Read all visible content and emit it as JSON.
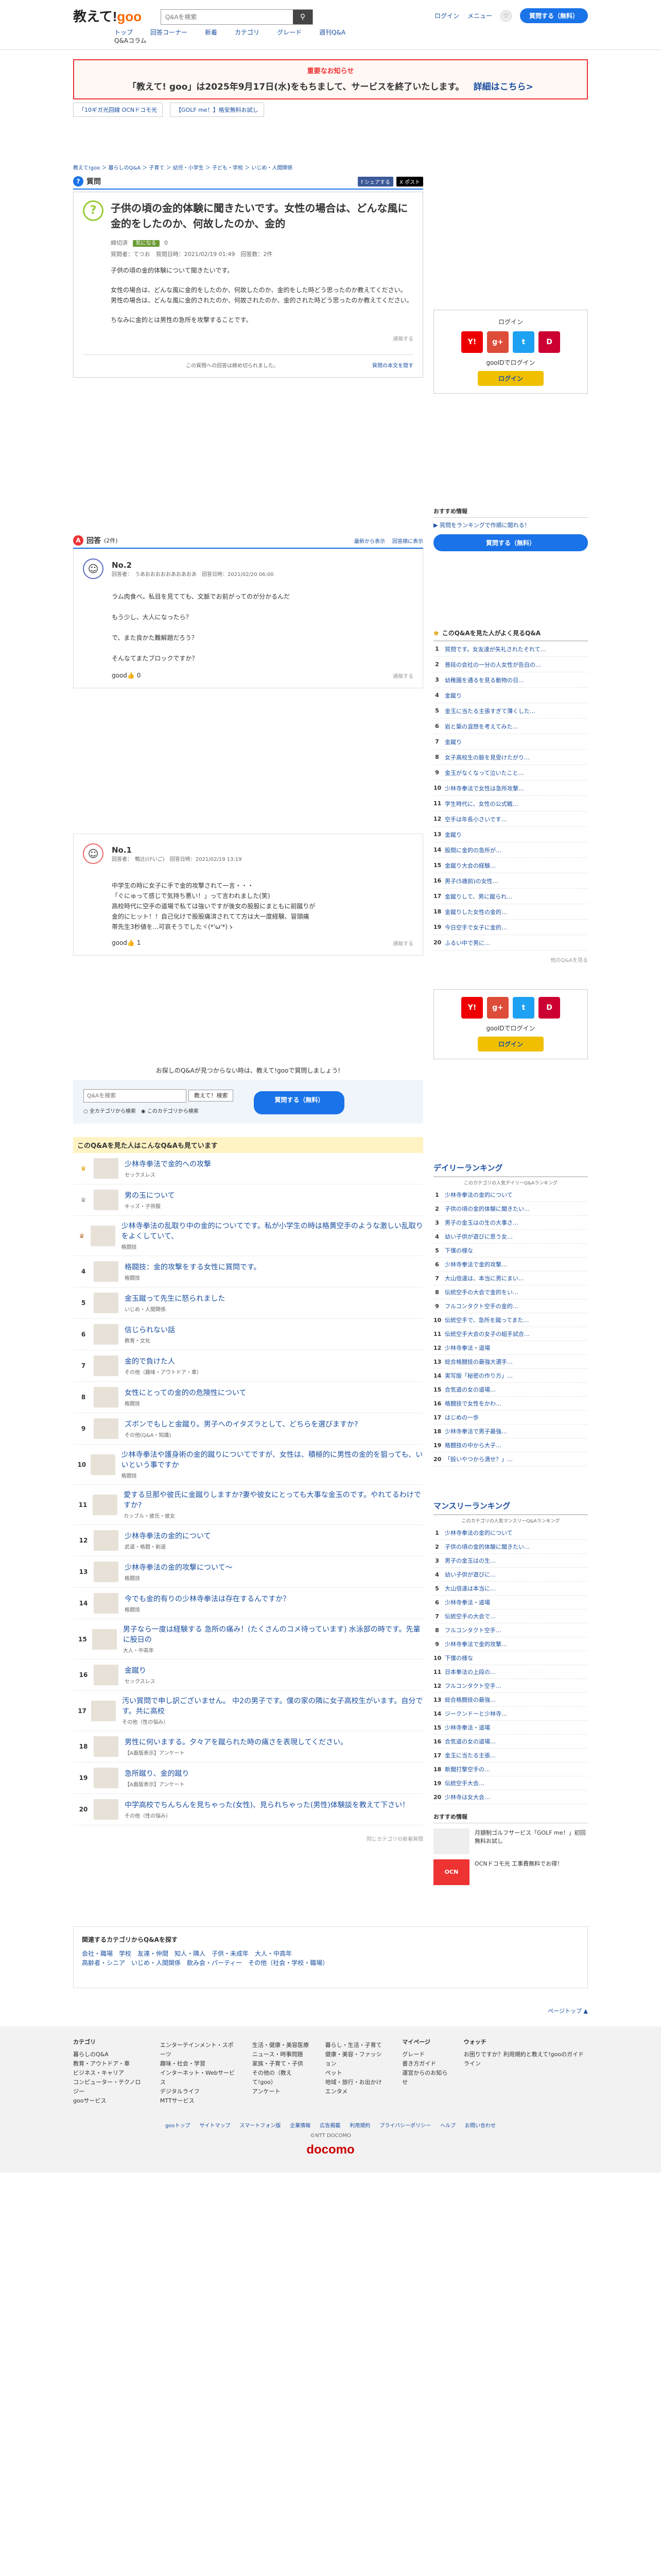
{
  "header": {
    "logo": "教えて!",
    "logo_goo": "goo",
    "search_placeholder": "Q&Aを検索",
    "search_icon": "search-icon",
    "login": "ログイン",
    "menu": "メニュー",
    "ask_button": "質問する（無料）",
    "nav": [
      "トップ",
      "回答コーナー",
      "新着",
      "カテゴリ",
      "グレード",
      "週刊Q&A"
    ],
    "nav2": "Q&Aコラム"
  },
  "notice": {
    "title": "重要なお知らせ",
    "body": "「教えて! goo」は2025年9月17日(水)をもちまして、サービスを終了いたします。",
    "link": "詳細はこちら>"
  },
  "promo": [
    "「10ギガ光回線 OCNドコモ光",
    "【GOLF me！】格安無料お試し"
  ],
  "breadcrumb": "教えて!goo ＞ 暮らしのQ&A ＞ 子育て ＞ 幼児・小学生 ＞ 子ども・学校 ＞ いじめ・人間関係",
  "question": {
    "label": "質問",
    "share": [
      "f シェアする",
      "X ポスト"
    ],
    "title": "子供の頃の金的体験に聞きたいです。女性の場合は、どんな風に金的をしたのか、何故したのか、金的",
    "user": "締切済",
    "badge": "気になる",
    "count": "0",
    "meta": "質問者：てつお　質問日時：2021/02/19 01:49　回答数：2件",
    "body": [
      "子供の頃の金的体験について聞きたいです。",
      "女性の場合は、どんな風に金的をしたのか、何故したのか、金的をした時どう思ったのか教えてください。\n男性の場合は、どんな風に金的されたのか、何故されたのか、金的された時どう思ったのか教えてください。",
      "ちなみに金的とは男性の急所を攻撃することです。"
    ],
    "report": "通報する",
    "closed": "この質問への回答は締め切られました。",
    "back": "質問の本文を隠す"
  },
  "answers": {
    "label": "回答",
    "count": "(2件)",
    "sort": [
      "最新から表示",
      "回答順に表示"
    ],
    "items": [
      {
        "no": "No.2",
        "meta": "回答者：　うあおおおおおあおあおあ　回答日時：2021/02/20 06:00",
        "body": [
          "ラム肉食べ。私目を見てても、文脈でお前がってのが分かるんだ",
          "もう少し、大人になったら？",
          "で、また良かた難解題だろう？",
          "そんなてまたブロックですか？"
        ],
        "good": "good",
        "good_n": "0",
        "report": "通報する"
      },
      {
        "no": "No.1",
        "meta": "回答者：　鴨辻(けいご)　回答日時：2021/02/19 13:19",
        "body": "中学生の時に女子に手で金的攻撃されて一言・・・\n「ぐにゅって感じで気持ち悪い！」って言われました(笑)\n高校時代に空手の道場で私ては強いですが後女の股股にまともに前蹴りが\n金的にヒット！！自己化けで股股痛済されてて方は大一度経験、冒頭痛\n帯先生3秒値を...可哀そうでしたヾ(*'ω'*)ゝ",
        "good": "good",
        "good_n": "1",
        "report": "通報する"
      }
    ]
  },
  "ask_prompt": "お探しのQ&Aが見つからない時は、教えて!gooで質問しましょう!",
  "ask_box": {
    "placeholder": "Q&Aを検索",
    "search_btn": "教えて！検索",
    "opt1": "全カテゴリから検索",
    "opt2": "このカテゴリから検索",
    "ask": "質問する（無料）"
  },
  "related": {
    "title": "このQ&Aを見た人はこんなQ&Aも見ています",
    "items": [
      {
        "t": "少林寺拳法で金的への攻撃",
        "c": "セックスレス"
      },
      {
        "t": "男の玉について",
        "c": "キッズ・子供服"
      },
      {
        "t": "少林寺拳法の乱取り中の金的についてです。私が小学生の時は格黄空手のような激しい乱取りをよくしていて、",
        "c": "格闘技"
      },
      {
        "t": "格闘技：金的攻撃をする女性に質問です。",
        "c": "格闘技"
      },
      {
        "t": "金玉蹴って先生に怒られました",
        "c": "いじめ・人間関係"
      },
      {
        "t": "信じられない話",
        "c": "教育・文化"
      },
      {
        "t": "金的で負けた人",
        "c": "その他（趣味・アウトドア・車）"
      },
      {
        "t": "女性にとっての金的の危険性について",
        "c": "格闘技"
      },
      {
        "t": "ズボンでもしと金蹴り。男子へのイタズラとして、どちらを選びますか?",
        "c": "その他(Q&A・知識)"
      },
      {
        "t": "少林寺拳法や護身術の金的蹴りについてですが、女性は、積極的に男性の金的を狙っても、いいという事ですか",
        "c": "格闘技"
      },
      {
        "t": "愛する旦那や彼氏に金蹴りしますか?妻や彼女にとっても大事な金玉のです。やれてるわけですか?",
        "c": "カップル・彼氏・彼女"
      },
      {
        "t": "少林寺拳法の金的について",
        "c": "武道・格闘・剣道"
      },
      {
        "t": "少林寺拳法の金的攻撃について〜",
        "c": "格闘技"
      },
      {
        "t": "今でも金的有りの少林寺拳法は存在するんですか？",
        "c": "格闘技"
      },
      {
        "t": "男子なら一度は経験する 急所の痛み！(たくさんのコメ待っています) 水泳部の時です。先輩に股日の",
        "c": "大人・中高年"
      },
      {
        "t": "金蹴り",
        "c": "セックスレス"
      },
      {
        "t": "汚い質問で申し訳ございません。 中2の男子です。僕の家の隣に女子高校生がいます。自分です。共に高校",
        "c": "その他（性の悩み）"
      },
      {
        "t": "男性に何いまする。夕々アを蹴られた時の痛さを表現してください。",
        "c": "【A面版表示】アンケート"
      },
      {
        "t": "急所蹴り、金的蹴り",
        "c": "【A面版表示】アンケート"
      },
      {
        "t": "中学高校でちんちんを見ちゃった(女性)、見られちゃった(男性)体験談を教えて下さい！",
        "c": "その他（性の悩み）"
      }
    ],
    "more": "同じカテゴリの新着質問"
  },
  "side": {
    "login_title": "ログイン",
    "sns": [
      "Y!",
      "g+",
      "t",
      "D"
    ],
    "goo_login": "gooIDでログイン",
    "login_btn": "ログイン",
    "promo_title": "おすすめ情報",
    "promo_link": "▶ 質問をランキングで作順に閲れる！",
    "promo_btn": "質問する（無料）",
    "rank_title": "このQ&Aを見た人がよく見るQ&A",
    "rank": [
      "質問です。女友達が失礼されたそれて…",
      "普段の会社の一分の人女性が告白の…",
      "幼稚園を通るを見る動物の日…",
      "金蹴り",
      "金玉に当たる主張すぎて薄くした…",
      "岩と築の混想を考えてみた…",
      "金蹴り",
      "女子高校生の脈を見受けたがり…",
      "金玉がなくなって泣いたこと…",
      "少林寺拳法で女性は急所攻撃…",
      "学生時代に、女性の公式戦…",
      "空手は年長小さいです…",
      "金蹴り",
      "股間に金的の急所が…",
      "金蹴り大会の経験…",
      "男子(5歳前)の女性…",
      "金蹴りして、男に蹴られ…",
      "金蹴りした女性の金的…",
      "今日空手で女子に金的…",
      "ふるい中で男に…"
    ],
    "rank_more": "他のQ&Aを見る",
    "daily_title": "デイリーランキング",
    "daily_sub": "このカテゴリの人気デイリーQ&Aランキング",
    "daily": [
      "少林寺拳法の金的について",
      "子供の頃の金的体験に聞きたい…",
      "男子の金玉はの生の大事さ…",
      "幼い子供が遊びに思う女…",
      "下僕の様な",
      "少林寺拳法で金的攻撃…",
      "大山倍達は、本当に男にまい…",
      "伝統空手の大会で金的をい…",
      "フルコンタクト空手の金的…",
      "伝統空手で、急所を蹴ってまた…",
      "伝統空手大会の女子の組手試合…",
      "少林寺拳法・道場",
      "総合格闘技の最強大選手…",
      "実写版「秘密の作り方」…",
      "合気道の女の道場…",
      "格闘技で女性をかわ…",
      "はじめの一歩",
      "少林寺拳法で男子最強…",
      "格闘技の中から大子…",
      "「殴いやつから潰せ？」…"
    ],
    "mansion_title": "マンスリーランキング",
    "mansion_sub": "このカテゴリの人気マンスリーQ&Aランキング",
    "mansion": [
      "少林寺拳法の金的について",
      "子供の頃の金的体験に聞きたい…",
      "男子の金玉はの生…",
      "幼い子供が遊びに…",
      "大山倍達は本当に…",
      "少林寺拳法・道場",
      "伝統空手の大会で…",
      "フルコンタクト空手…",
      "少林寺拳法で金的攻撃…",
      "下僕の様な",
      "日本拳法の上段の…",
      "フルコンタクト空手…",
      "総合格闘技の最強…",
      "ジークンドーと少林寺…",
      "少林寺拳法・道場",
      "合気道の女の道場…",
      "金玉に当たる主張…",
      "新聞打撃空手の…",
      "伝統空手大会…",
      "少林寺は女大会…"
    ],
    "osusume_title": "おすすめ情報",
    "osu1": "月額制ゴルフサービス「GOLF me！」初回無料お試し",
    "osu2": "OCNドコモ光 工事費無料でお得！",
    "osu2_tag": "OCN"
  },
  "bottom_cats": {
    "title": "関連するカテゴリからQ&Aを探す",
    "links": "会社・職場　学校　友達・仲間　知人・隣人　子供・未成年　大人・中高年\n高齢者・シニア　いじめ・人間関係　飲み会・パーティー　その他（社会・学校・職場）"
  },
  "pagetop": "ページトップ",
  "footer": {
    "cols": [
      {
        "h": "カテゴリ",
        "items": [
          "暮らしのQ&A",
          "教育・アウトドア・車",
          "ビジネス・キャリア",
          "コンピューター・テクノロジー",
          "gooサービス"
        ]
      },
      {
        "h": "",
        "items": [
          "エンターテインメント・スポーツ",
          "趣味・社会・学習",
          "インターネット・Webサービス",
          "デジタルライフ",
          "MTTサービス"
        ]
      },
      {
        "h": "",
        "items": [
          "生活・健康・美容医療",
          "ニュース・時事問題",
          "家族・子育て・子供",
          "その他の（教えて!goo）",
          "アンケート"
        ]
      },
      {
        "h": "",
        "items": [
          "暮らし・生活・子育て",
          "健康・美容・ファッション",
          "ペット",
          "地域・旅行・お出かけ",
          "エンタメ"
        ]
      },
      {
        "h": "マイページ",
        "items": [
          "グレード",
          "書き方ガイド",
          "運営からのお知らせ"
        ]
      },
      {
        "h": "ウォッチ",
        "items": [
          "お困りですか？利用規約と教えて!gooのガイドライン"
        ]
      }
    ],
    "links": [
      "gooトップ",
      "サイトマップ",
      "スマートフォン版",
      "企業情報",
      "広告掲載",
      "利用規約",
      "プライバシーポリシー",
      "ヘルプ",
      "お問い合わせ"
    ],
    "copy": "©NTT DOCOMO",
    "docomo": "docomo"
  }
}
